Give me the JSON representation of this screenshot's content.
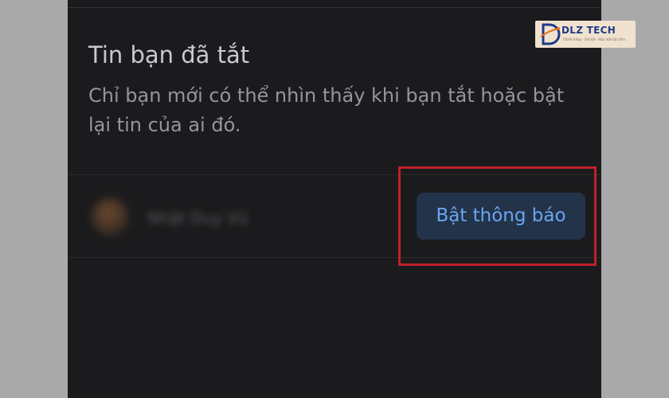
{
  "muted_stories": {
    "title": "Tin bạn đã tắt",
    "description": "Chỉ bạn mới có thể nhìn thấy khi bạn tắt hoặc bật lại tin của ai đó."
  },
  "contact": {
    "name": "Nhật Duy Vũ"
  },
  "actions": {
    "unmute_label": "Bật thông báo"
  },
  "watermark": {
    "brand": "DLZ TECH",
    "tagline": "Chính hãng - Giá tốt - Hậu mãi tận tâm"
  },
  "colors": {
    "page_background": "#a9a9a9",
    "panel_background": "#1b1b1d",
    "button_background": "#233349",
    "button_text": "#6aa6f2",
    "highlight_border": "#c0202c"
  }
}
